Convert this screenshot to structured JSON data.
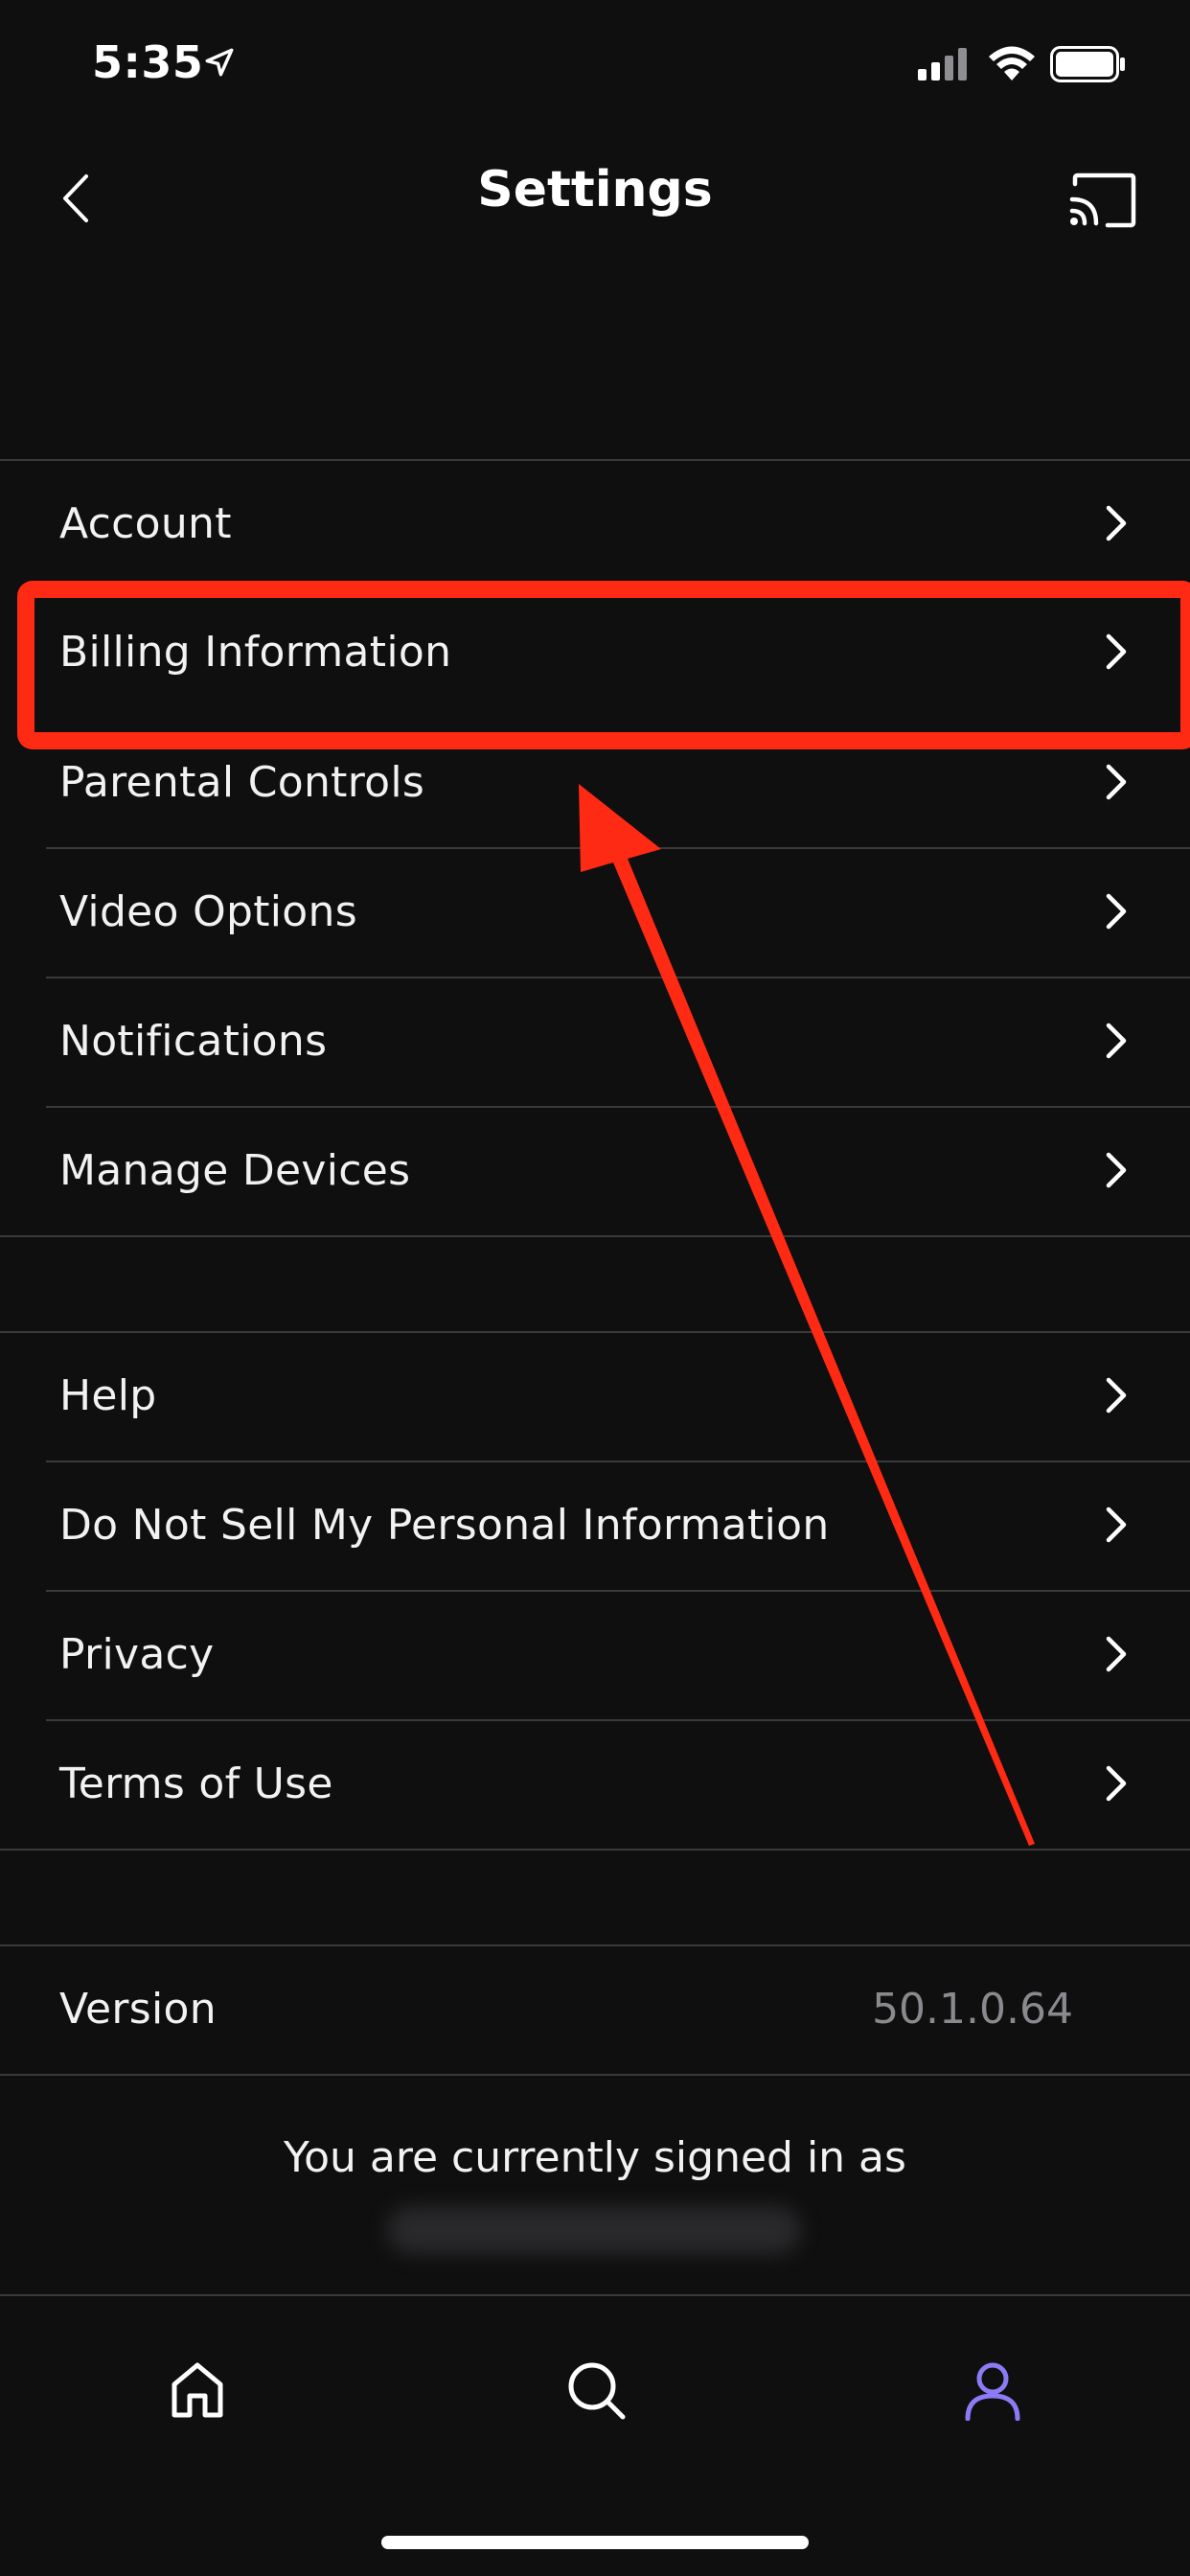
{
  "status_bar": {
    "time": "5:35"
  },
  "nav": {
    "title": "Settings"
  },
  "groups": {
    "main": [
      "Account",
      "Billing Information",
      "Parental Controls",
      "Video Options",
      "Notifications",
      "Manage Devices"
    ],
    "support": [
      "Help",
      "Do Not Sell My Personal Information",
      "Privacy",
      "Terms of Use"
    ]
  },
  "version": {
    "label": "Version",
    "value": "50.1.0.64"
  },
  "signed_in": {
    "text": "You are currently signed in as"
  },
  "tabs": [
    "home-icon",
    "search-icon",
    "profile-icon"
  ],
  "colors": {
    "accent": "#8b7cf6",
    "annotation": "#ff2a13",
    "background": "#0f0f10"
  }
}
